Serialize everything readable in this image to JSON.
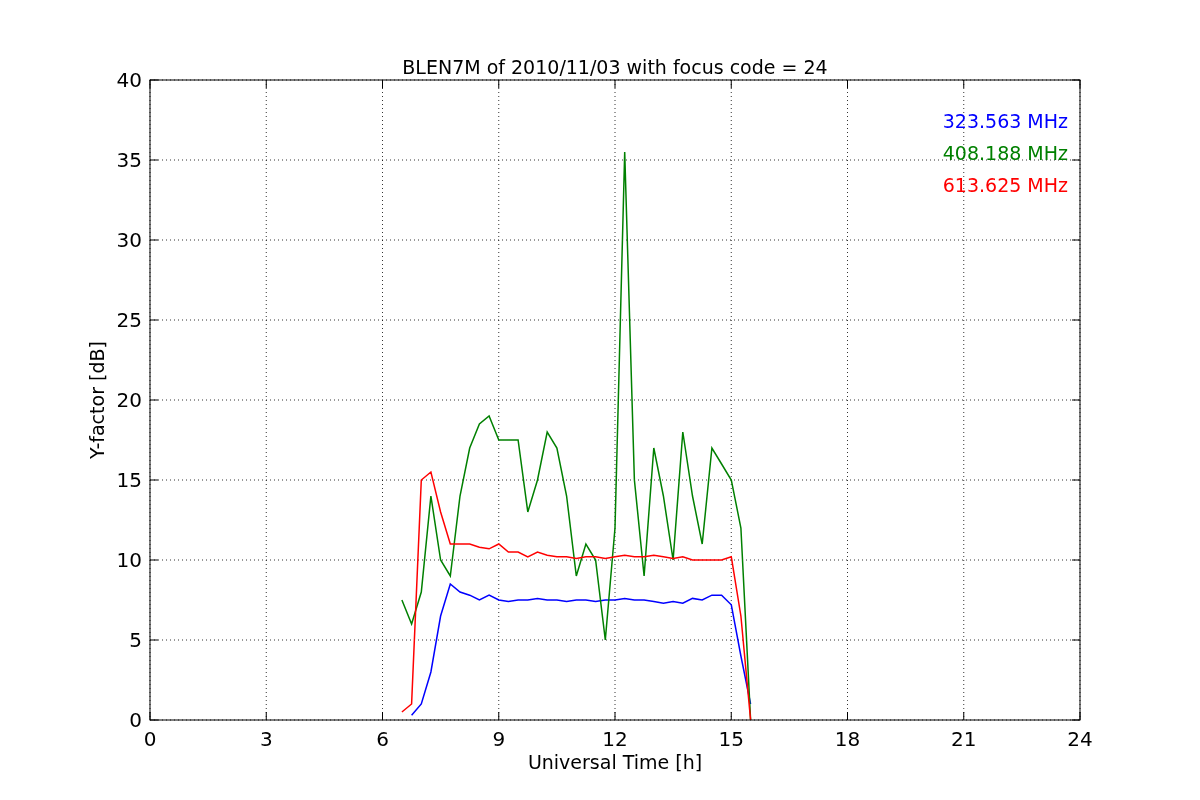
{
  "figure": {
    "chart_data": {
      "type": "line",
      "title": "BLEN7M of 2010/11/03 with focus code = 24",
      "xlabel": "Universal Time [h]",
      "ylabel": "Y-factor [dB]",
      "x": [
        6.5,
        6.75,
        7,
        7.25,
        7.5,
        7.75,
        8,
        8.25,
        8.5,
        8.75,
        9,
        9.25,
        9.5,
        9.75,
        10,
        10.25,
        10.5,
        10.75,
        11,
        11.25,
        11.5,
        11.75,
        12,
        12.25,
        12.5,
        12.75,
        13,
        13.25,
        13.5,
        13.75,
        14,
        14.25,
        14.5,
        14.75,
        15,
        15.25,
        15.5
      ],
      "series": [
        {
          "name": "323.563 MHz",
          "color": "#0000ff",
          "values": [
            null,
            0.3,
            1,
            3,
            6.5,
            8.5,
            8,
            7.8,
            7.5,
            7.8,
            7.5,
            7.4,
            7.5,
            7.5,
            7.6,
            7.5,
            7.5,
            7.4,
            7.5,
            7.5,
            7.4,
            7.5,
            7.5,
            7.6,
            7.5,
            7.5,
            7.4,
            7.3,
            7.4,
            7.3,
            7.6,
            7.5,
            7.8,
            7.8,
            7.2,
            4,
            1
          ]
        },
        {
          "name": "408.188 MHz",
          "color": "#008000",
          "values": [
            7.5,
            6,
            8,
            14,
            10,
            9,
            14,
            17,
            18.5,
            19,
            17.5,
            17.5,
            17.5,
            13,
            15,
            18,
            17,
            14,
            9,
            11,
            10,
            5,
            12,
            35.5,
            15,
            9,
            17,
            14,
            10,
            18,
            14,
            11,
            17,
            16,
            15,
            12,
            0
          ]
        },
        {
          "name": "613.625 MHz",
          "color": "#ff0000",
          "values": [
            0.5,
            1,
            15,
            15.5,
            13,
            11,
            11,
            11,
            10.8,
            10.7,
            11,
            10.5,
            10.5,
            10.2,
            10.5,
            10.3,
            10.2,
            10.2,
            10.1,
            10.2,
            10.2,
            10.1,
            10.2,
            10.3,
            10.2,
            10.2,
            10.3,
            10.2,
            10.1,
            10.2,
            10,
            10,
            10,
            10,
            10.2,
            6.5,
            0
          ]
        }
      ],
      "grid": true,
      "xlim": [
        0,
        24
      ],
      "ylim": [
        0,
        40
      ],
      "xticks": [
        0,
        3,
        6,
        9,
        12,
        15,
        18,
        21,
        24
      ],
      "yticks": [
        0,
        5,
        10,
        15,
        20,
        25,
        30,
        35,
        40
      ]
    }
  }
}
